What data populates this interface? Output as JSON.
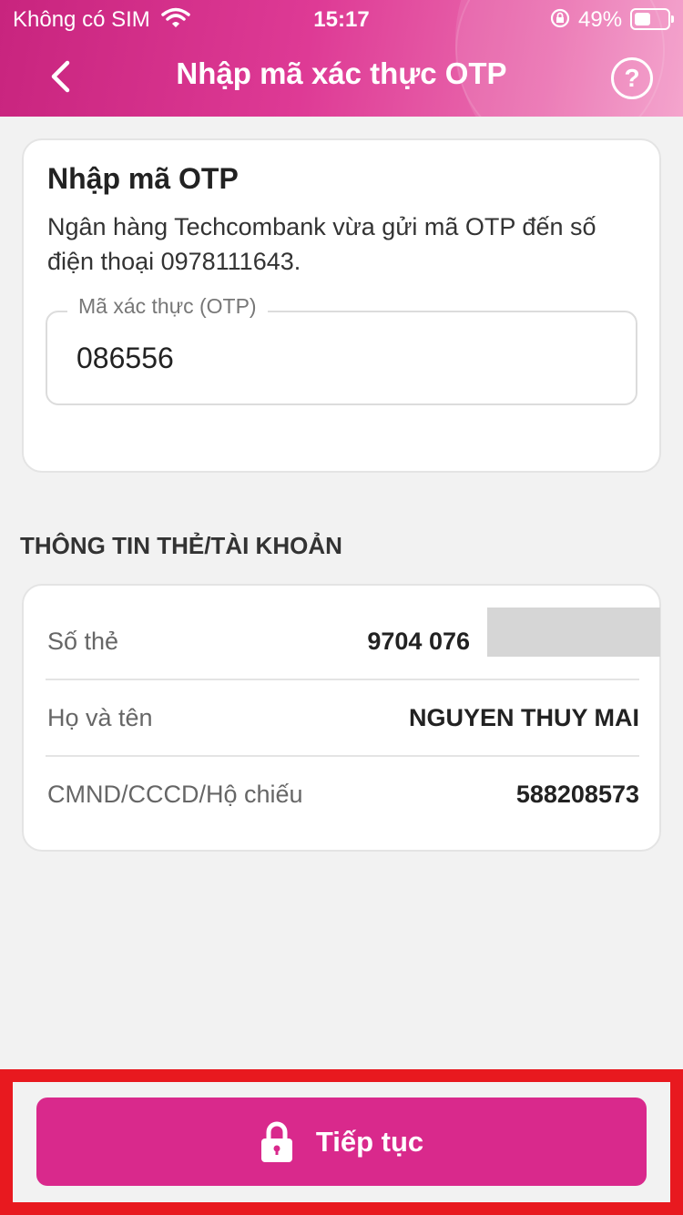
{
  "status_bar": {
    "carrier": "Không có SIM",
    "time": "15:17",
    "battery": "49%"
  },
  "header": {
    "title": "Nhập mã xác thực OTP",
    "back_icon": "chevron-left-icon",
    "help_label": "?"
  },
  "otp_card": {
    "title": "Nhập mã OTP",
    "description": "Ngân hàng Techcombank vừa gửi mã OTP đến số điện thoại 0978111643.",
    "field_label": "Mã xác thực (OTP)",
    "field_value": "086556"
  },
  "info_section": {
    "title": "THÔNG TIN THẺ/TÀI KHOẢN",
    "rows": [
      {
        "label": "Số thẻ",
        "value": "9704 076"
      },
      {
        "label": "Họ và tên",
        "value": "NGUYEN THUY MAI"
      },
      {
        "label": "CMND/CCCD/Hộ chiếu",
        "value": "588208573"
      }
    ]
  },
  "footer": {
    "continue_label": "Tiếp tục",
    "continue_icon": "lock-icon"
  },
  "colors": {
    "brand": "#d9298c",
    "highlight": "#e8191f"
  }
}
